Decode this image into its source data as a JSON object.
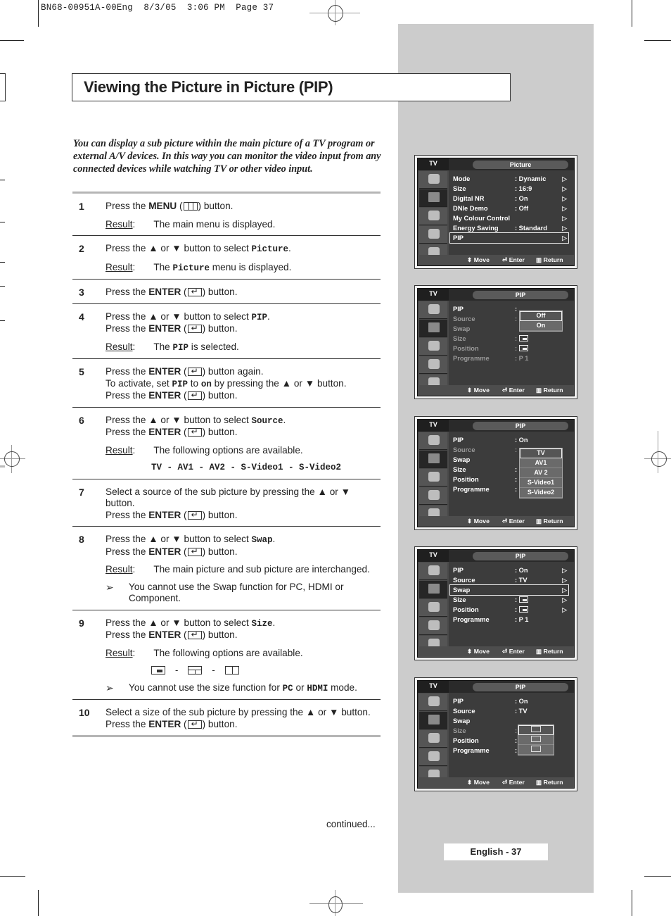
{
  "print_slug": "BN68-00951A-00Eng  8/3/05  3:06 PM  Page 37",
  "page_title": "Viewing the Picture in Picture (PIP)",
  "intro": "You can display a sub picture within the main picture of a TV program or external A/V devices. In this way you can monitor the video input from any connected devices while watching TV or other video input.",
  "result_label": "Result",
  "steps": [
    {
      "num": "1",
      "lines": [
        [
          "Press the ",
          {
            "b": "MENU"
          },
          " (",
          {
            "icon": "menu"
          },
          ") button."
        ]
      ],
      "result": "The main menu is displayed."
    },
    {
      "num": "2",
      "lines": [
        [
          "Press the ▲ or ▼ button to select ",
          {
            "m": "Picture"
          },
          "."
        ]
      ],
      "result_parts": [
        "The ",
        {
          "m": "Picture"
        },
        " menu is displayed."
      ]
    },
    {
      "num": "3",
      "lines": [
        [
          "Press the ",
          {
            "b": "ENTER"
          },
          " (",
          {
            "icon": "enter"
          },
          ") button."
        ]
      ]
    },
    {
      "num": "4",
      "lines": [
        [
          "Press the ▲ or ▼ button to select ",
          {
            "m": "PIP"
          },
          "."
        ],
        [
          "Press the ",
          {
            "b": "ENTER"
          },
          " (",
          {
            "icon": "enter"
          },
          ") button."
        ]
      ],
      "result_parts": [
        "The ",
        {
          "m": "PIP"
        },
        " is selected."
      ]
    },
    {
      "num": "5",
      "lines": [
        [
          "Press the ",
          {
            "b": "ENTER"
          },
          " (",
          {
            "icon": "enter"
          },
          ") button again."
        ],
        [
          "To activate, set ",
          {
            "m": "PIP"
          },
          " to ",
          {
            "m": "on"
          },
          " by pressing the ▲ or ▼ button."
        ],
        [
          "Press the ",
          {
            "b": "ENTER"
          },
          " (",
          {
            "icon": "enter"
          },
          ") button."
        ]
      ]
    },
    {
      "num": "6",
      "lines": [
        [
          "Press the ▲ or ▼ button to select ",
          {
            "m": "Source"
          },
          "."
        ],
        [
          "Press the ",
          {
            "b": "ENTER"
          },
          " (",
          {
            "icon": "enter"
          },
          ") button."
        ]
      ],
      "result": "The following options are available.",
      "options": "TV - AV1 - AV2 - S-Video1 - S-Video2"
    },
    {
      "num": "7",
      "lines": [
        [
          "Select a source of the sub picture by pressing the ▲ or ▼ button."
        ],
        [
          "Press the ",
          {
            "b": "ENTER"
          },
          " (",
          {
            "icon": "enter"
          },
          ") button."
        ]
      ]
    },
    {
      "num": "8",
      "lines": [
        [
          "Press the ▲ or ▼ button to select ",
          {
            "m": "Swap"
          },
          "."
        ],
        [
          "Press the ",
          {
            "b": "ENTER"
          },
          " (",
          {
            "icon": "enter"
          },
          ") button."
        ]
      ],
      "result": "The main picture and sub picture are interchanged.",
      "note_parts": [
        "You cannot use the Swap function for PC, HDMI or Component."
      ]
    },
    {
      "num": "9",
      "lines": [
        [
          "Press the ▲ or ▼ button to select ",
          {
            "m": "Size"
          },
          "."
        ],
        [
          "Press the ",
          {
            "b": "ENTER"
          },
          " (",
          {
            "icon": "enter"
          },
          ") button."
        ]
      ],
      "result": "The following options are available.",
      "size_icons": [
        "small-window",
        "double-window-top",
        "split-window"
      ],
      "note_parts": [
        "You cannot use the size function for ",
        {
          "m": "PC"
        },
        " or ",
        {
          "m": "HDMI"
        },
        " mode."
      ]
    },
    {
      "num": "10",
      "lines": [
        [
          "Select a size of the sub picture by pressing the ▲ or ▼ button."
        ],
        [
          "Press the ",
          {
            "b": "ENTER"
          },
          " (",
          {
            "icon": "enter"
          },
          ") button."
        ]
      ]
    }
  ],
  "note_arrow": "➢",
  "size_separator": "-",
  "continued": "continued...",
  "page_label": "English - 37",
  "osd_common": {
    "tv_label": "TV",
    "footer": {
      "move": "Move",
      "enter": "Enter",
      "return": "Return"
    },
    "sidebar_icons": [
      "input-icon",
      "picture-icon",
      "sound-icon",
      "channel-icon",
      "setup-icon"
    ],
    "selected_sidebar": 1
  },
  "screens": [
    {
      "title": "Picture",
      "rows": [
        {
          "label": "Mode",
          "value": ": Dynamic",
          "arrow": true
        },
        {
          "label": "Size",
          "value": ": 16:9",
          "arrow": true
        },
        {
          "label": "Digital NR",
          "value": ": On",
          "arrow": true
        },
        {
          "label": "DNIe Demo",
          "value": ": Off",
          "arrow": true
        },
        {
          "label": "My Colour Control",
          "value": "",
          "arrow": true
        },
        {
          "label": "Energy Saving",
          "value": ": Standard",
          "arrow": true
        },
        {
          "label": "PIP",
          "value": "",
          "arrow": true,
          "highlight": true
        }
      ]
    },
    {
      "title": "PIP",
      "rows": [
        {
          "label": "PIP",
          "value": ":"
        },
        {
          "label": "Source",
          "value": ":",
          "dim": true
        },
        {
          "label": "Swap",
          "value": "",
          "dim": true
        },
        {
          "label": "Size",
          "value": ":",
          "mini": true,
          "dim": true
        },
        {
          "label": "Position",
          "value": ":",
          "mini": true,
          "dim": true
        },
        {
          "label": "Programme",
          "value": ": P    1",
          "dim": true
        }
      ],
      "dropdown": {
        "items": [
          "Off",
          "On"
        ],
        "selected": 0
      }
    },
    {
      "title": "PIP",
      "rows": [
        {
          "label": "PIP",
          "value": ": On"
        },
        {
          "label": "Source",
          "value": ":",
          "dim": true
        },
        {
          "label": "Swap",
          "value": ""
        },
        {
          "label": "Size",
          "value": ":"
        },
        {
          "label": "Position",
          "value": ":"
        },
        {
          "label": "Programme",
          "value": ":"
        }
      ],
      "dropdown": {
        "items": [
          "TV",
          "AV1",
          "AV 2",
          "S-Video1",
          "S-Video2"
        ],
        "selected": 0
      }
    },
    {
      "title": "PIP",
      "rows": [
        {
          "label": "PIP",
          "value": ": On",
          "arrow": true
        },
        {
          "label": "Source",
          "value": ": TV",
          "arrow": true
        },
        {
          "label": "Swap",
          "value": "",
          "arrow": true,
          "highlight": true
        },
        {
          "label": "Size",
          "value": ":",
          "mini": true,
          "arrow": true
        },
        {
          "label": "Position",
          "value": ":",
          "mini": true,
          "arrow": true
        },
        {
          "label": "Programme",
          "value": ": P    1"
        }
      ]
    },
    {
      "title": "PIP",
      "rows": [
        {
          "label": "PIP",
          "value": ": On"
        },
        {
          "label": "Source",
          "value": ": TV"
        },
        {
          "label": "Swap",
          "value": ""
        },
        {
          "label": "Size",
          "value": ":",
          "dim": true
        },
        {
          "label": "Position",
          "value": ":"
        },
        {
          "label": "Programme",
          "value": ":"
        }
      ],
      "dropdown": {
        "items": [
          "small-window",
          "double-window",
          "split-window"
        ],
        "selected": 0,
        "icons": true
      }
    }
  ]
}
